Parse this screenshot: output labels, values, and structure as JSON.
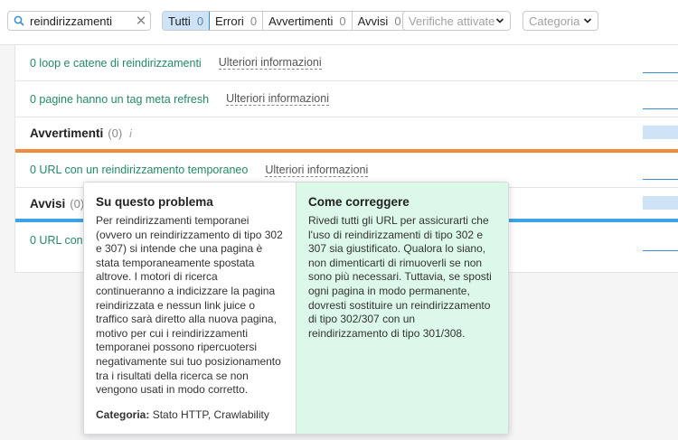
{
  "search": {
    "value": "reindirizzamenti"
  },
  "filters": [
    {
      "label": "Tutti",
      "count": "0",
      "active": true
    },
    {
      "label": "Errori",
      "count": "0"
    },
    {
      "label": "Avvertimenti",
      "count": "0"
    },
    {
      "label": "Avvisi",
      "count": "0"
    }
  ],
  "dropdowns": {
    "checks": "Verifiche attivate",
    "category": "Categoria"
  },
  "rows": {
    "loops": {
      "text": "0 loop e catene di reindirizzamenti",
      "link": "Ulteriori informazioni"
    },
    "meta_refresh": {
      "text": "0 pagine hanno un tag meta refresh",
      "link": "Ulteriori informazioni"
    },
    "temp_redirect": {
      "text": "0 URL con un reindirizzamento temporaneo",
      "link": "Ulteriori informazioni"
    },
    "notice_row": {
      "text": "0 URL con u"
    }
  },
  "sections": {
    "warnings": {
      "title": "Avvertimenti",
      "count": "(0)",
      "info": "i"
    },
    "notices": {
      "title": "Avvisi",
      "count": "(0)"
    }
  },
  "colors": {
    "warning_stripe": "#f08a3c",
    "notice_stripe": "#3ea3e8",
    "tip_right_bg": "#dbf8e8",
    "ok_text": "#238a63"
  },
  "tooltip": {
    "about_title": "Su questo problema",
    "about_body": "Per reindirizzamenti temporanei (ovvero un reindirizzamento di tipo 302 e 307) si intende che una pagina è stata temporaneamente spostata altrove. I motori di ricerca continueranno a indicizzare la pagina reindirizzata e nessun link juice o traffico sarà diretto alla nuova pagina, motivo per cui i reindirizzamenti temporanei possono ripercuotersi negativamente sui tuo posizionamento tra i risultati della ricerca se non vengono usati in modo corretto.",
    "category_label": "Categoria:",
    "category_value": "Stato HTTP, Crawlability",
    "fix_title": "Come correggere",
    "fix_body": "Rivedi tutti gli URL per assicurarti che l'uso di reindirizzamenti di tipo 302 e 307 sia giustificato. Qualora lo siano, non dimenticarti di rimuoverli se non sono più necessari. Tuttavia, se sposti ogni pagina in modo permanente, dovresti sostituire un reindirizzamento di tipo 302/307 con un reindirizzamento di tipo 301/308."
  }
}
